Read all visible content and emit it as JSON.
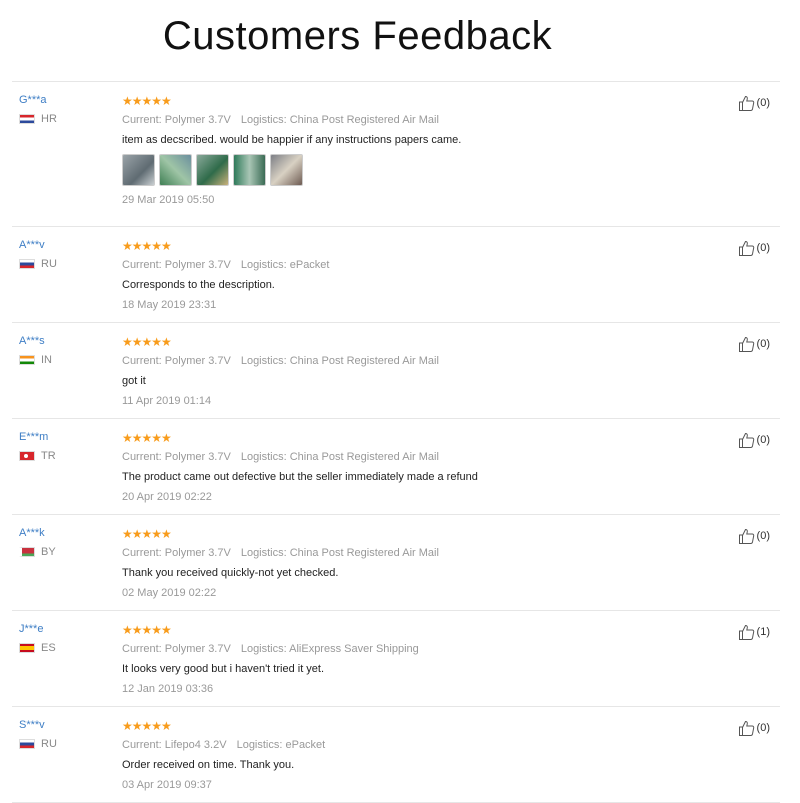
{
  "page": {
    "title": "Customers Feedback"
  },
  "colors": {
    "star": "#f89c1c",
    "username": "#3e7ec5",
    "meta": "#999999"
  },
  "reviews": [
    {
      "user": "G***a",
      "country": "HR",
      "flag": "hr",
      "stars": "★★★★★",
      "attrs": {
        "current": "Current: Polymer 3.7V",
        "logistics": "Logistics: China Post Registered Air Mail"
      },
      "text": "item as decscribed. would be happier if any instructions papers came.",
      "photos": 5,
      "date": "29 Mar 2019 05:50",
      "helpful": "(0)"
    },
    {
      "user": "A***v",
      "country": "RU",
      "flag": "ru",
      "stars": "★★★★★",
      "attrs": {
        "current": "Current: Polymer 3.7V",
        "logistics": "Logistics: ePacket"
      },
      "text": "Corresponds to the description.",
      "date": "18 May 2019 23:31",
      "helpful": "(0)"
    },
    {
      "user": "A***s",
      "country": "IN",
      "flag": "in",
      "stars": "★★★★★",
      "attrs": {
        "current": "Current: Polymer 3.7V",
        "logistics": "Logistics: China Post Registered Air Mail"
      },
      "text": "got it",
      "date": "11 Apr 2019 01:14",
      "helpful": "(0)"
    },
    {
      "user": "E***m",
      "country": "TR",
      "flag": "tr",
      "stars": "★★★★★",
      "attrs": {
        "current": "Current: Polymer 3.7V",
        "logistics": "Logistics: China Post Registered Air Mail"
      },
      "text": "The product came out defective but the seller immediately made a refund",
      "date": "20 Apr 2019 02:22",
      "helpful": "(0)"
    },
    {
      "user": "A***k",
      "country": "BY",
      "flag": "by",
      "stars": "★★★★★",
      "attrs": {
        "current": "Current: Polymer 3.7V",
        "logistics": "Logistics: China Post Registered Air Mail"
      },
      "text": "Thank you received quickly-not yet checked.",
      "date": "02 May 2019 02:22",
      "helpful": "(0)"
    },
    {
      "user": "J***e",
      "country": "ES",
      "flag": "es",
      "stars": "★★★★★",
      "attrs": {
        "current": "Current: Polymer 3.7V",
        "logistics": "Logistics: AliExpress Saver Shipping"
      },
      "text": "It looks very good but i haven't tried it yet.",
      "date": "12 Jan 2019 03:36",
      "helpful": "(1)"
    },
    {
      "user": "S***v",
      "country": "RU",
      "flag": "ru",
      "stars": "★★★★★",
      "attrs": {
        "current": "Current: Lifepo4 3.2V",
        "logistics": "Logistics: ePacket"
      },
      "text": "Order received on time. Thank you.",
      "date": "03 Apr 2019 09:37",
      "helpful": "(0)"
    }
  ]
}
